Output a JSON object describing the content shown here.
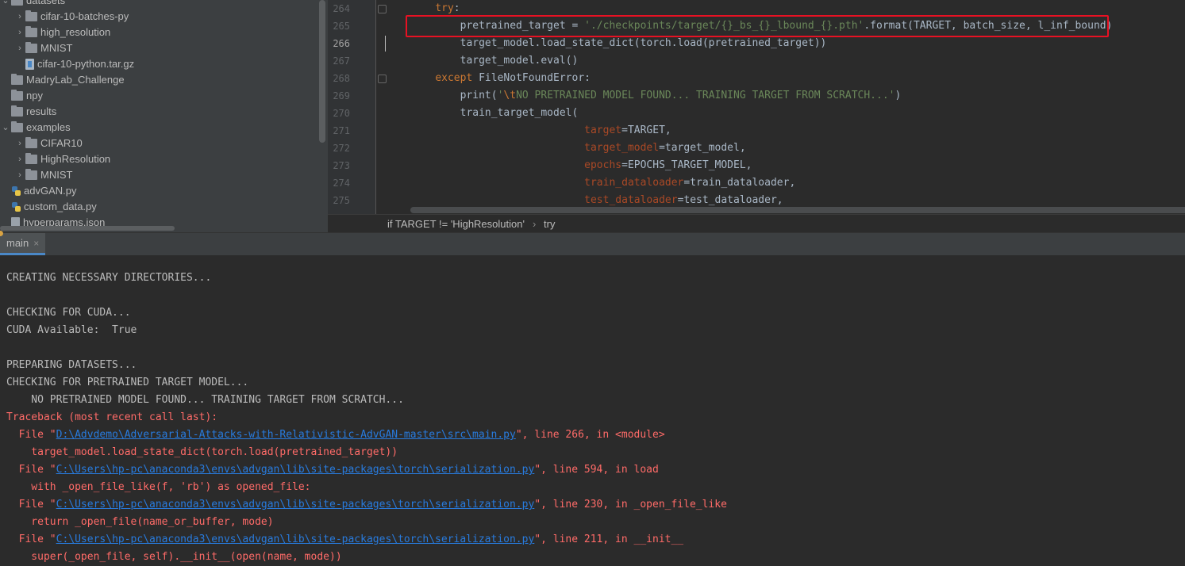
{
  "project_tree": {
    "items": [
      {
        "label": "datasets",
        "type": "folder",
        "indent": 0,
        "arrow": "open"
      },
      {
        "label": "cifar-10-batches-py",
        "type": "folder",
        "indent": 1,
        "arrow": "closed"
      },
      {
        "label": "high_resolution",
        "type": "folder",
        "indent": 1,
        "arrow": "closed"
      },
      {
        "label": "MNIST",
        "type": "folder",
        "indent": 1,
        "arrow": "closed"
      },
      {
        "label": "cifar-10-python.tar.gz",
        "type": "archive",
        "indent": 1,
        "arrow": "none"
      },
      {
        "label": "MadryLab_Challenge",
        "type": "folder",
        "indent": 0,
        "arrow": "none"
      },
      {
        "label": "npy",
        "type": "folder",
        "indent": 0,
        "arrow": "none"
      },
      {
        "label": "results",
        "type": "folder",
        "indent": 0,
        "arrow": "none"
      },
      {
        "label": "examples",
        "type": "folder",
        "indent": 0,
        "arrow": "open"
      },
      {
        "label": "CIFAR10",
        "type": "folder",
        "indent": 1,
        "arrow": "closed"
      },
      {
        "label": "HighResolution",
        "type": "folder",
        "indent": 1,
        "arrow": "closed"
      },
      {
        "label": "MNIST",
        "type": "folder",
        "indent": 1,
        "arrow": "closed"
      },
      {
        "label": "advGAN.py",
        "type": "python",
        "indent": 0,
        "arrow": "none"
      },
      {
        "label": "custom_data.py",
        "type": "python",
        "indent": 0,
        "arrow": "none"
      },
      {
        "label": "hyperparams.json",
        "type": "json",
        "indent": 0,
        "arrow": "none"
      }
    ]
  },
  "editor": {
    "lines": [
      {
        "num": "264",
        "html": "    <span class=\"kw\">try</span>:"
      },
      {
        "num": "265",
        "html": "        pretrained_target = <span class=\"str\">'./checkpoints/target/{}_bs_{}_lbound_{}.pth'</span>.format(TARGET, batch_size, l_inf_bound)"
      },
      {
        "num": "266",
        "html": "        target_model.load_state_dict(torch.load(pretrained_target))"
      },
      {
        "num": "267",
        "html": "        target_model.eval()"
      },
      {
        "num": "268",
        "html": "    <span class=\"kw\">except</span> <span class=\"cls\">FileNotFoundError</span>:"
      },
      {
        "num": "269",
        "html": "        print(<span class=\"str\">'</span><span class=\"esc\">\\t</span><span class=\"str\">NO PRETRAINED MODEL FOUND... TRAINING TARGET FROM SCRATCH...'</span>)"
      },
      {
        "num": "270",
        "html": "        train_target_model("
      },
      {
        "num": "271",
        "html": "                            <span class=\"param\">target</span>=TARGET,"
      },
      {
        "num": "272",
        "html": "                            <span class=\"param\">target_model</span>=target_model,"
      },
      {
        "num": "273",
        "html": "                            <span class=\"param\">epochs</span>=EPOCHS_TARGET_MODEL,"
      },
      {
        "num": "274",
        "html": "                            <span class=\"param\">train_dataloader</span>=train_dataloader,"
      },
      {
        "num": "275",
        "html": "                            <span class=\"param\">test_dataloader</span>=test_dataloader,"
      }
    ],
    "current_line": "266",
    "breadcrumb": {
      "first": "if TARGET != 'HighResolution'",
      "separator": "›",
      "second": "try"
    }
  },
  "run_tab": {
    "label": "main",
    "close": "×"
  },
  "console": {
    "lines": [
      {
        "text": "CREATING NECESSARY DIRECTORIES...",
        "kind": "out"
      },
      {
        "text": "",
        "kind": "out"
      },
      {
        "text": "CHECKING FOR CUDA...",
        "kind": "out"
      },
      {
        "text": "CUDA Available:  True",
        "kind": "out"
      },
      {
        "text": "",
        "kind": "out"
      },
      {
        "text": "PREPARING DATASETS...",
        "kind": "out"
      },
      {
        "text": "CHECKING FOR PRETRAINED TARGET MODEL...",
        "kind": "out"
      },
      {
        "text": "    NO PRETRAINED MODEL FOUND... TRAINING TARGET FROM SCRATCH...",
        "kind": "out"
      },
      {
        "text": "Traceback (most recent call last):",
        "kind": "err"
      },
      {
        "pre": "  File \"",
        "link": "D:\\Advdemo\\Adversarial-Attacks-with-Relativistic-AdvGAN-master\\src\\main.py",
        "post": "\", line 266, in <module>",
        "kind": "err"
      },
      {
        "text": "    target_model.load_state_dict(torch.load(pretrained_target))",
        "kind": "err"
      },
      {
        "pre": "  File \"",
        "link": "C:\\Users\\hp-pc\\anaconda3\\envs\\advgan\\lib\\site-packages\\torch\\serialization.py",
        "post": "\", line 594, in load",
        "kind": "err"
      },
      {
        "text": "    with _open_file_like(f, 'rb') as opened_file:",
        "kind": "err"
      },
      {
        "pre": "  File \"",
        "link": "C:\\Users\\hp-pc\\anaconda3\\envs\\advgan\\lib\\site-packages\\torch\\serialization.py",
        "post": "\", line 230, in _open_file_like",
        "kind": "err"
      },
      {
        "text": "    return _open_file(name_or_buffer, mode)",
        "kind": "err"
      },
      {
        "pre": "  File \"",
        "link": "C:\\Users\\hp-pc\\anaconda3\\envs\\advgan\\lib\\site-packages\\torch\\serialization.py",
        "post": "\", line 211, in __init__",
        "kind": "err"
      },
      {
        "text": "    super(_open_file, self).__init__(open(name, mode))",
        "kind": "err"
      }
    ]
  }
}
